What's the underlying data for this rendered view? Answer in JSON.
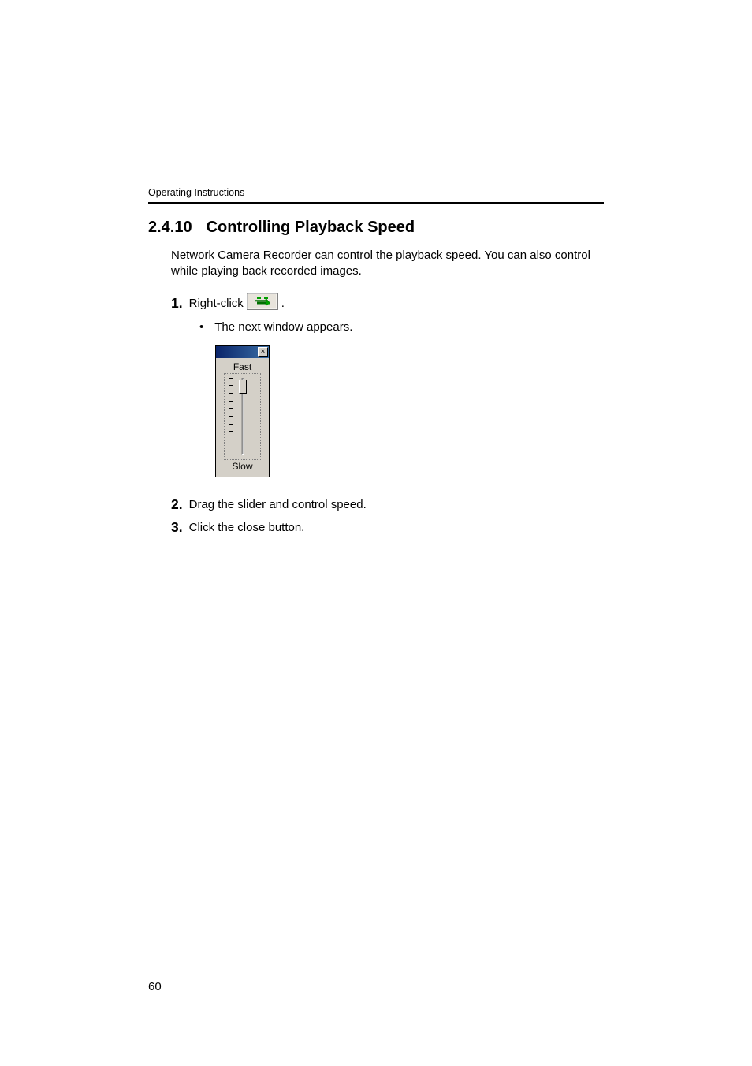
{
  "header": {
    "label": "Operating Instructions"
  },
  "section": {
    "number": "2.4.10",
    "title": "Controlling Playback Speed"
  },
  "intro": "Network Camera Recorder can control the playback speed. You can also control while playing back recorded images.",
  "steps": {
    "s1": {
      "num": "1.",
      "pre": "Right-click ",
      "post": " ."
    },
    "s1_bullet": "The next window appears.",
    "s2": {
      "num": "2.",
      "text": "Drag the slider and control speed."
    },
    "s3": {
      "num": "3.",
      "text": "Click the close button."
    }
  },
  "slider_window": {
    "fast_label": "Fast",
    "slow_label": "Slow",
    "close_glyph": "×"
  },
  "page_number": "60"
}
